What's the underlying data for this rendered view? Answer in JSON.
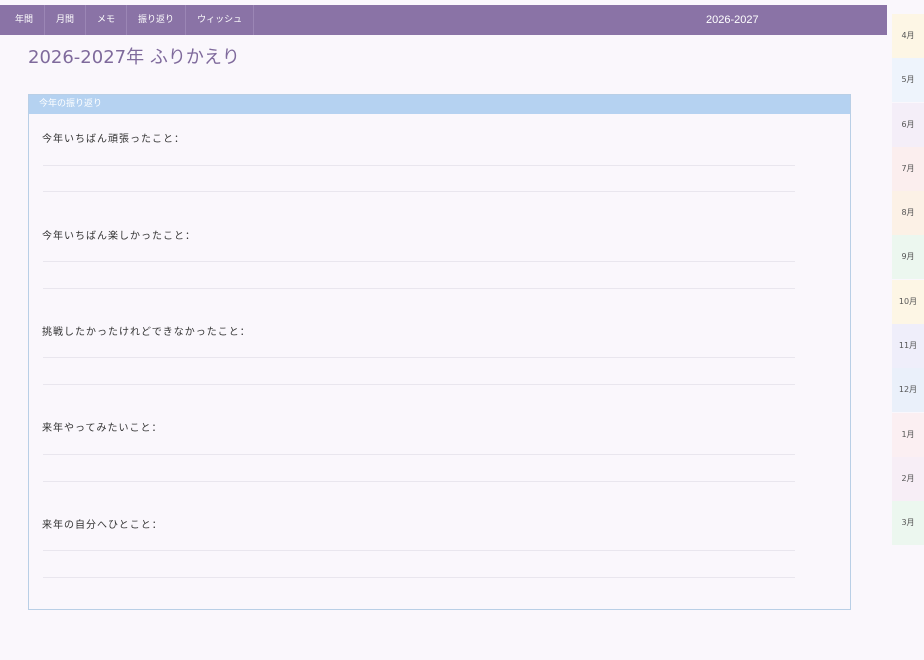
{
  "nav": {
    "items": [
      "年間",
      "月間",
      "メモ",
      "振り返り",
      "ウィッシュ"
    ],
    "year": "2026-2027"
  },
  "page": {
    "title": "2026-2027年 ふりかえり"
  },
  "panel": {
    "header": "今年の振り返り",
    "questions": [
      "今年いちばん頑張ったこと：",
      "今年いちばん楽しかったこと：",
      "挑戦したかったけれどできなかったこと：",
      "来年やってみたいこと：",
      "来年の自分へひとこと："
    ]
  },
  "months": [
    {
      "label": "4月",
      "color": "#fdf6e5"
    },
    {
      "label": "5月",
      "color": "#eef4fc"
    },
    {
      "label": "6月",
      "color": "#f4eef8"
    },
    {
      "label": "7月",
      "color": "#fbeeee"
    },
    {
      "label": "8月",
      "color": "#fcf1e6"
    },
    {
      "label": "9月",
      "color": "#ecf7ef"
    },
    {
      "label": "10月",
      "color": "#fdf6e5"
    },
    {
      "label": "11月",
      "color": "#efeefa"
    },
    {
      "label": "12月",
      "color": "#eaf0fa"
    },
    {
      "label": "1月",
      "color": "#fbeff2"
    },
    {
      "label": "2月",
      "color": "#f7eef6"
    },
    {
      "label": "3月",
      "color": "#ecf7ef"
    }
  ]
}
